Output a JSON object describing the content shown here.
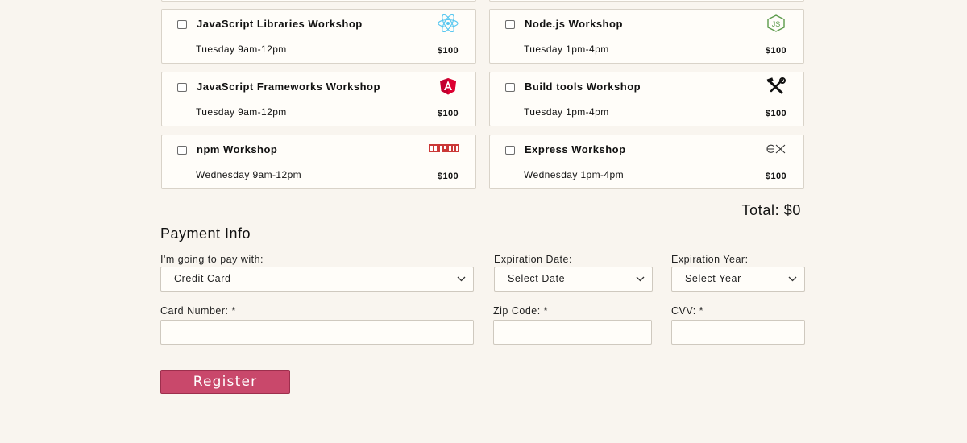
{
  "workshops": [
    {
      "title": "JavaScript Libraries Workshop",
      "time": "Tuesday 9am-12pm",
      "price": "$100",
      "icon": "react-icon"
    },
    {
      "title": "Node.js Workshop",
      "time": "Tuesday 1pm-4pm",
      "price": "$100",
      "icon": "nodejs-icon"
    },
    {
      "title": "JavaScript Frameworks Workshop",
      "time": "Tuesday 9am-12pm",
      "price": "$100",
      "icon": "angular-icon"
    },
    {
      "title": "Build tools Workshop",
      "time": "Tuesday 1pm-4pm",
      "price": "$100",
      "icon": "tools-icon"
    },
    {
      "title": "npm Workshop",
      "time": "Wednesday 9am-12pm",
      "price": "$100",
      "icon": "npm-icon"
    },
    {
      "title": "Express Workshop",
      "time": "Wednesday 1pm-4pm",
      "price": "$100",
      "icon": "express-icon"
    }
  ],
  "total_label": "Total: $0",
  "payment": {
    "heading": "Payment Info",
    "method_label": "I'm going to pay with:",
    "method_value": "Credit Card",
    "exp_date_label": "Expiration Date:",
    "exp_date_value": "Select Date",
    "exp_year_label": "Expiration Year:",
    "exp_year_value": "Select Year",
    "card_number_label": "Card Number: *",
    "zip_label": "Zip Code: *",
    "cvv_label": "CVV: *"
  },
  "register_label": "Register",
  "colors": {
    "accent": "#c9486b",
    "background": "#f9f5ef",
    "card": "#fffdf9"
  }
}
